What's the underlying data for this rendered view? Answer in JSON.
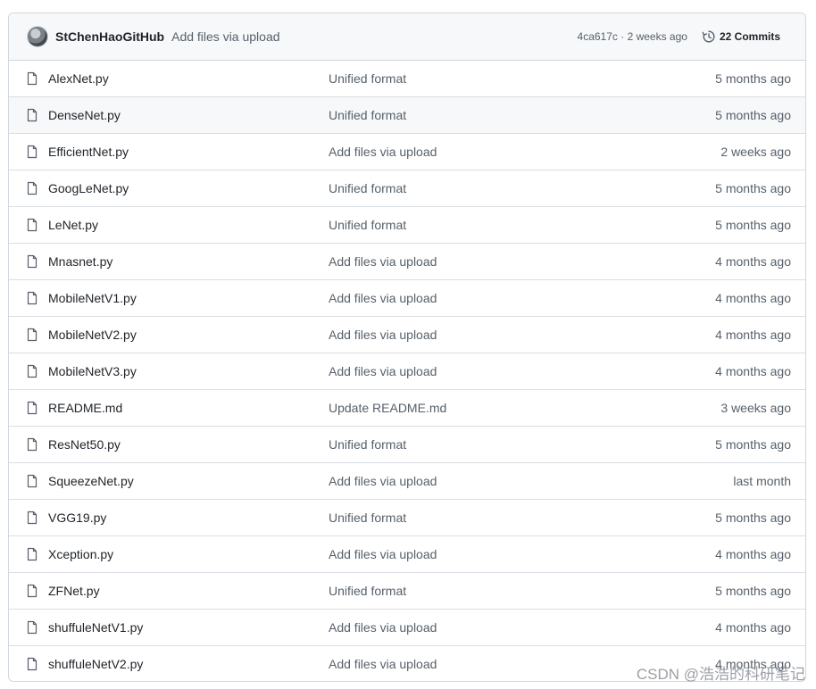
{
  "commit": {
    "author": "StChenHaoGitHub",
    "message": "Add files via upload",
    "sha": "4ca617c",
    "separator": " · ",
    "time": "2 weeks ago",
    "commits_label": "22 Commits"
  },
  "files": [
    {
      "name": "AlexNet.py",
      "commit": "Unified format",
      "age": "5 months ago"
    },
    {
      "name": "DenseNet.py",
      "commit": "Unified format",
      "age": "5 months ago"
    },
    {
      "name": "EfficientNet.py",
      "commit": "Add files via upload",
      "age": "2 weeks ago"
    },
    {
      "name": "GoogLeNet.py",
      "commit": "Unified format",
      "age": "5 months ago"
    },
    {
      "name": "LeNet.py",
      "commit": "Unified format",
      "age": "5 months ago"
    },
    {
      "name": "Mnasnet.py",
      "commit": "Add files via upload",
      "age": "4 months ago"
    },
    {
      "name": "MobileNetV1.py",
      "commit": "Add files via upload",
      "age": "4 months ago"
    },
    {
      "name": "MobileNetV2.py",
      "commit": "Add files via upload",
      "age": "4 months ago"
    },
    {
      "name": "MobileNetV3.py",
      "commit": "Add files via upload",
      "age": "4 months ago"
    },
    {
      "name": "README.md",
      "commit": "Update README.md",
      "age": "3 weeks ago"
    },
    {
      "name": "ResNet50.py",
      "commit": "Unified format",
      "age": "5 months ago"
    },
    {
      "name": "SqueezeNet.py",
      "commit": "Add files via upload",
      "age": "last month"
    },
    {
      "name": "VGG19.py",
      "commit": "Unified format",
      "age": "5 months ago"
    },
    {
      "name": "Xception.py",
      "commit": "Add files via upload",
      "age": "4 months ago"
    },
    {
      "name": "ZFNet.py",
      "commit": "Unified format",
      "age": "5 months ago"
    },
    {
      "name": "shuffuleNetV1.py",
      "commit": "Add files via upload",
      "age": "4 months ago"
    },
    {
      "name": "shuffuleNetV2.py",
      "commit": "Add files via upload",
      "age": "4 months ago"
    }
  ],
  "watermark": "CSDN @浩浩的科研笔记",
  "icons": {
    "file": "file-icon",
    "history": "history-icon",
    "avatar": "avatar"
  },
  "colors": {
    "header_bg": "#f6f8fa",
    "border": "#d0d7de",
    "muted_text": "#57606a",
    "primary_text": "#1f2328"
  }
}
